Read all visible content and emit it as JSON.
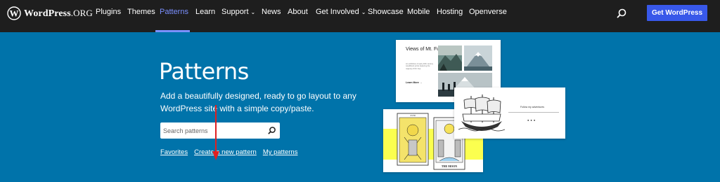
{
  "logo": {
    "brand": "WordPress",
    "tld": ".ORG"
  },
  "nav": {
    "items": [
      {
        "label": "Plugins"
      },
      {
        "label": "Themes"
      },
      {
        "label": "Patterns",
        "active": true
      },
      {
        "label": "Learn"
      },
      {
        "label": "Support",
        "dropdown": true
      },
      {
        "label": "News"
      },
      {
        "label": "About"
      },
      {
        "label": "Get Involved",
        "dropdown": true
      },
      {
        "label": "Showcase"
      },
      {
        "label": "Mobile"
      },
      {
        "label": "Hosting"
      },
      {
        "label": "Openverse"
      }
    ],
    "cta_label": "Get WordPress"
  },
  "hero": {
    "title": "Patterns",
    "description": "Add a beautifully designed, ready to go layout to any WordPress site with a simple copy/paste.",
    "search_placeholder": "Search patterns",
    "links": [
      {
        "label": "Favorites"
      },
      {
        "label": "Create a new pattern"
      },
      {
        "label": "My patterns"
      }
    ]
  },
  "previews": {
    "fuji": {
      "title": "Views of Mt. Fuji",
      "description": "An exhibition of early 20th century woodblock prints featuring the majesty of Mt. Fuji",
      "learn_more": "Learn More →"
    },
    "ship": {
      "follow": "Follow my adventures"
    },
    "tarot": {
      "numeral": "XVIII",
      "caption": "THE MOON"
    }
  },
  "colors": {
    "nav_bg": "#1e1e1e",
    "hero_bg": "#0073aa",
    "active_link": "#7b90ff",
    "cta_bg": "#3858e9",
    "annotation_arrow": "#e02020"
  },
  "icons": {
    "nav_search": "search-icon",
    "search_button": "search-icon",
    "annotation": "red-arrow-icon"
  }
}
